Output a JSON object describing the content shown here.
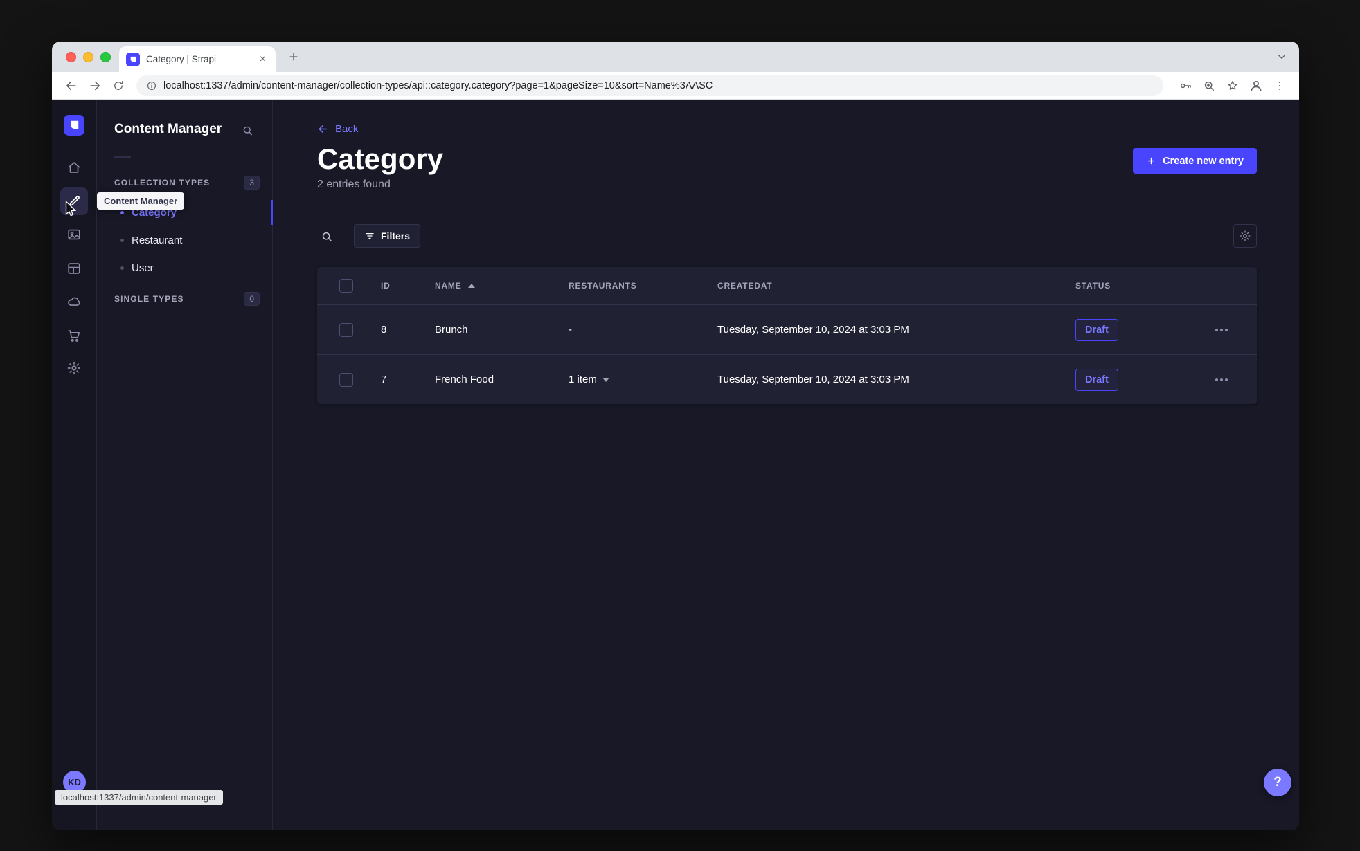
{
  "colors": {
    "accent": "#4945ff",
    "link": "#7b79ff",
    "page_bg": "#181826",
    "surface": "#212134",
    "status_draft_text": "#7b79ff"
  },
  "browser": {
    "tab_title": "Category | Strapi",
    "close_tab": "×",
    "url": "localhost:1337/admin/content-manager/collection-types/api::category.category?page=1&pageSize=10&sort=Name%3AASC",
    "status_bubble": "localhost:1337/admin/content-manager"
  },
  "sidebar": {
    "tooltip": "Content Manager",
    "avatar_initials": "KD",
    "help": "?"
  },
  "subnav": {
    "title": "Content Manager",
    "sections": [
      {
        "label": "COLLECTION TYPES",
        "badge": "3"
      },
      {
        "label": "SINGLE TYPES",
        "badge": "0"
      }
    ],
    "items": [
      {
        "label": "Category"
      },
      {
        "label": "Restaurant"
      },
      {
        "label": "User"
      }
    ]
  },
  "content": {
    "back_label": "Back",
    "title": "Category",
    "subtitle": "2 entries found",
    "create_button": "Create new entry",
    "filters_button": "Filters"
  },
  "table": {
    "headers": {
      "id": "ID",
      "name": "NAME",
      "restaurants": "RESTAURANTS",
      "createdat": "CREATEDAT",
      "status": "STATUS"
    },
    "rows": [
      {
        "id": "8",
        "name": "Brunch",
        "restaurants": "-",
        "createdat": "Tuesday, September 10, 2024 at 3:03 PM",
        "status": "Draft"
      },
      {
        "id": "7",
        "name": "French Food",
        "restaurants": "1 item",
        "createdat": "Tuesday, September 10, 2024 at 3:03 PM",
        "status": "Draft"
      }
    ]
  }
}
